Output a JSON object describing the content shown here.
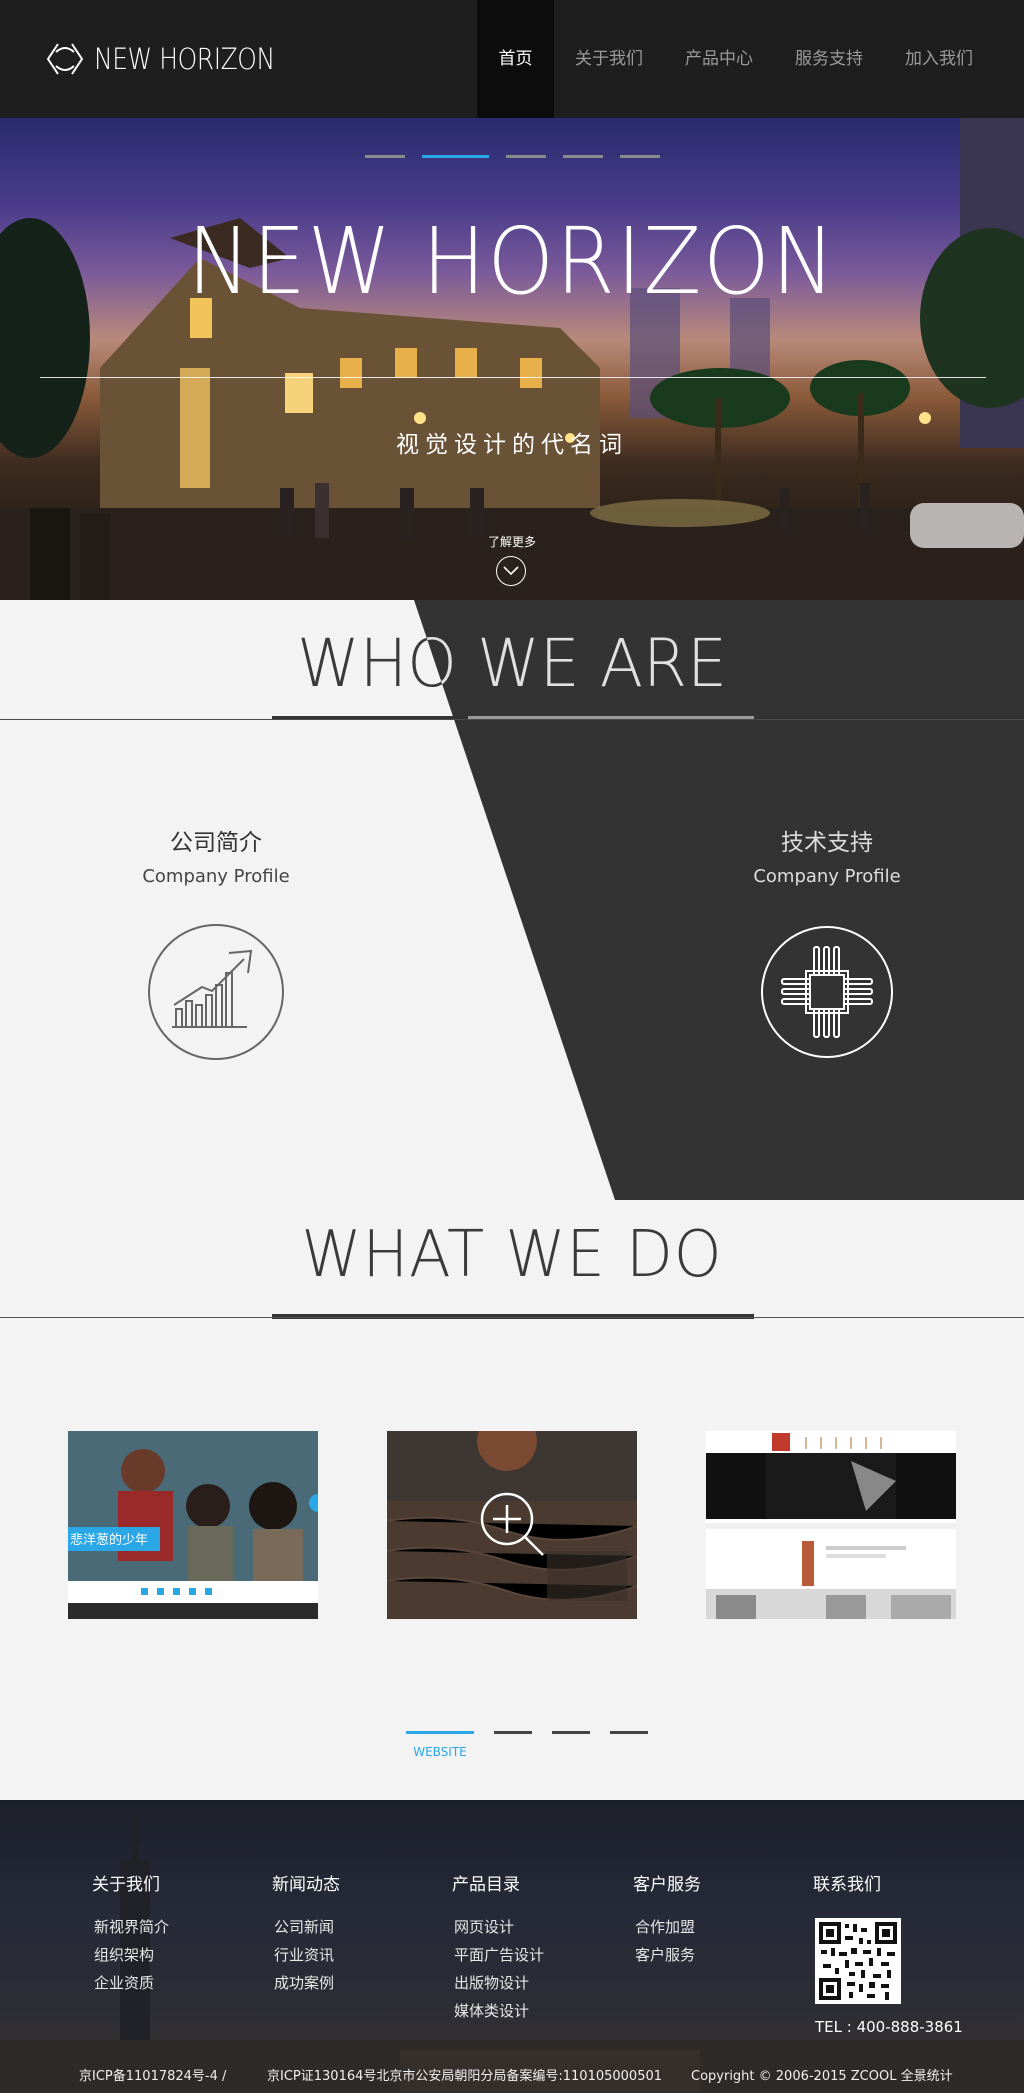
{
  "header": {
    "logo_text": "NEW HORIZON",
    "nav": [
      {
        "label": "首页",
        "active": true
      },
      {
        "label": "关于我们",
        "active": false
      },
      {
        "label": "产品中心",
        "active": false
      },
      {
        "label": "服务支持",
        "active": false
      },
      {
        "label": "加入我们",
        "active": false
      }
    ]
  },
  "hero": {
    "title": "NEW HORIZON",
    "subtitle": "视觉设计的代名词",
    "more_label": "了解更多",
    "slides": 5,
    "active_slide": 2
  },
  "who": {
    "title": "WHO WE ARE",
    "left": {
      "title": "公司简介",
      "subtitle": "Company Profile",
      "icon": "chart-growth-icon"
    },
    "right": {
      "title": "技术支持",
      "subtitle": "Company Profile",
      "icon": "chip-icon"
    }
  },
  "what": {
    "title": "WHAT WE DO",
    "cards": [
      {
        "caption": "悲洋葱的少年",
        "kind": "photo"
      },
      {
        "caption": "",
        "kind": "zoom"
      },
      {
        "caption": "",
        "kind": "web"
      }
    ],
    "tabs": 4,
    "active_tab": 1,
    "tab_label": "WEBSITE"
  },
  "footer": {
    "columns": [
      {
        "head": "关于我们",
        "links": [
          "新视界简介",
          "组织架构",
          "企业资质"
        ]
      },
      {
        "head": "新闻动态",
        "links": [
          "公司新闻",
          "行业资讯",
          "成功案例"
        ]
      },
      {
        "head": "产品目录",
        "links": [
          "网页设计",
          "平面广告设计",
          "出版物设计",
          "媒体类设计"
        ]
      },
      {
        "head": "客户服务",
        "links": [
          "合作加盟",
          "客户服务"
        ]
      },
      {
        "head": "联系我们",
        "links": []
      }
    ],
    "tel": "TEL : 400-888-3861",
    "icp1": "京ICP备11017824号-4 /",
    "icp2": "京ICP证130164号北京市公安局朝阳分局备案编号:110105000501",
    "copyright": "Copyright © 2006-2015 ZCOOL 全景统计"
  },
  "colors": {
    "accent": "#2aa7e6",
    "dark": "#333333",
    "header": "#1e1e1e"
  }
}
